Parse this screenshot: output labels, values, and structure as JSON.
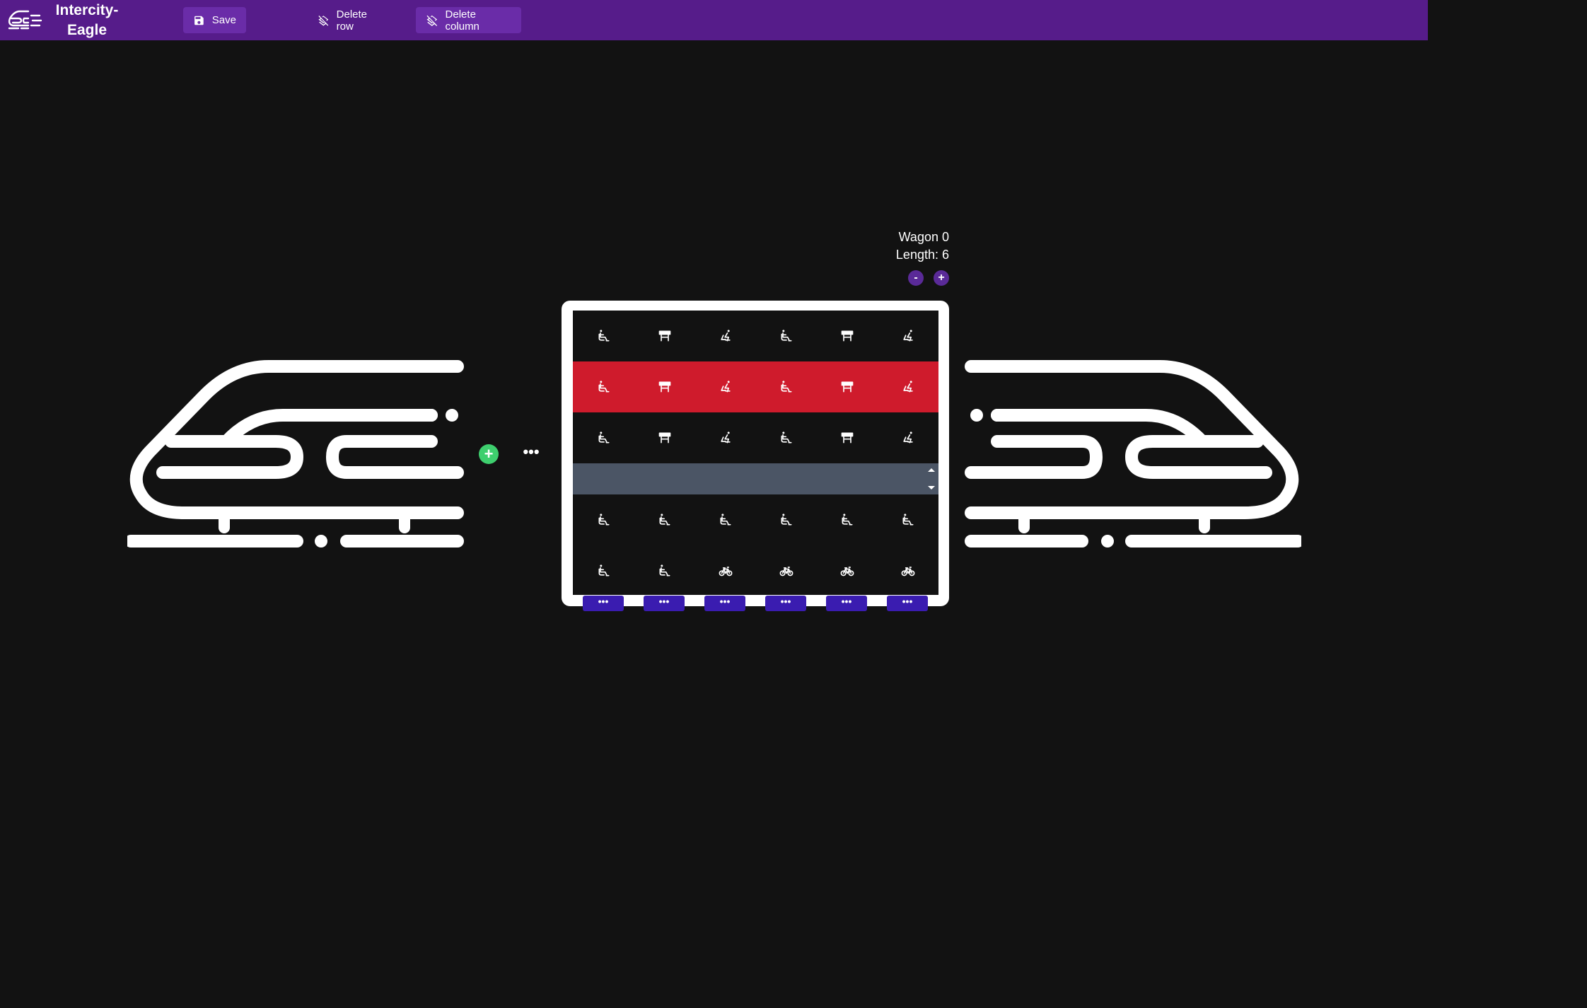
{
  "app": {
    "title": "Intercity-Eagle",
    "logo_icon": "train-icon"
  },
  "toolbar": {
    "save_label": "Save",
    "save_icon": "floppy-disk-icon",
    "delete_row_label": "Delete row",
    "delete_row_icon": "layers-off-icon",
    "delete_column_label": "Delete column",
    "delete_column_icon": "layers-off-icon"
  },
  "colors": {
    "topbar": "#561c8a",
    "button": "#6a2ca8",
    "selected_row": "#cf1b2c",
    "aisle": "#4b5565",
    "add_button": "#3ecf6e",
    "column_button": "#3a1cb0",
    "background": "#121212"
  },
  "between": {
    "add_label": "+",
    "more_label": "•••"
  },
  "wagon": {
    "name": "Wagon 0",
    "length_label": "Length: 6",
    "minus_label": "-",
    "plus_label": "+",
    "column_button_label": "•••",
    "columns": 6,
    "selected_row_index": 1,
    "rows": [
      {
        "type": "seats",
        "cells": [
          "wheelchair-seat-icon",
          "table-icon",
          "recline-seat-icon",
          "wheelchair-seat-icon",
          "table-icon",
          "recline-seat-icon"
        ]
      },
      {
        "type": "seats",
        "cells": [
          "wheelchair-seat-icon",
          "table-icon",
          "recline-seat-icon",
          "wheelchair-seat-icon",
          "table-icon",
          "recline-seat-icon"
        ]
      },
      {
        "type": "seats",
        "cells": [
          "wheelchair-seat-icon",
          "table-icon",
          "recline-seat-icon",
          "wheelchair-seat-icon",
          "table-icon",
          "recline-seat-icon"
        ]
      },
      {
        "type": "aisle",
        "cells": []
      },
      {
        "type": "seats",
        "cells": [
          "wheelchair-seat-icon",
          "wheelchair-seat-icon",
          "wheelchair-seat-icon",
          "wheelchair-seat-icon",
          "wheelchair-seat-icon",
          "wheelchair-seat-icon"
        ]
      },
      {
        "type": "seats",
        "cells": [
          "wheelchair-seat-icon",
          "wheelchair-seat-icon",
          "bicycle-icon",
          "bicycle-icon",
          "bicycle-icon",
          "bicycle-icon"
        ]
      }
    ]
  }
}
